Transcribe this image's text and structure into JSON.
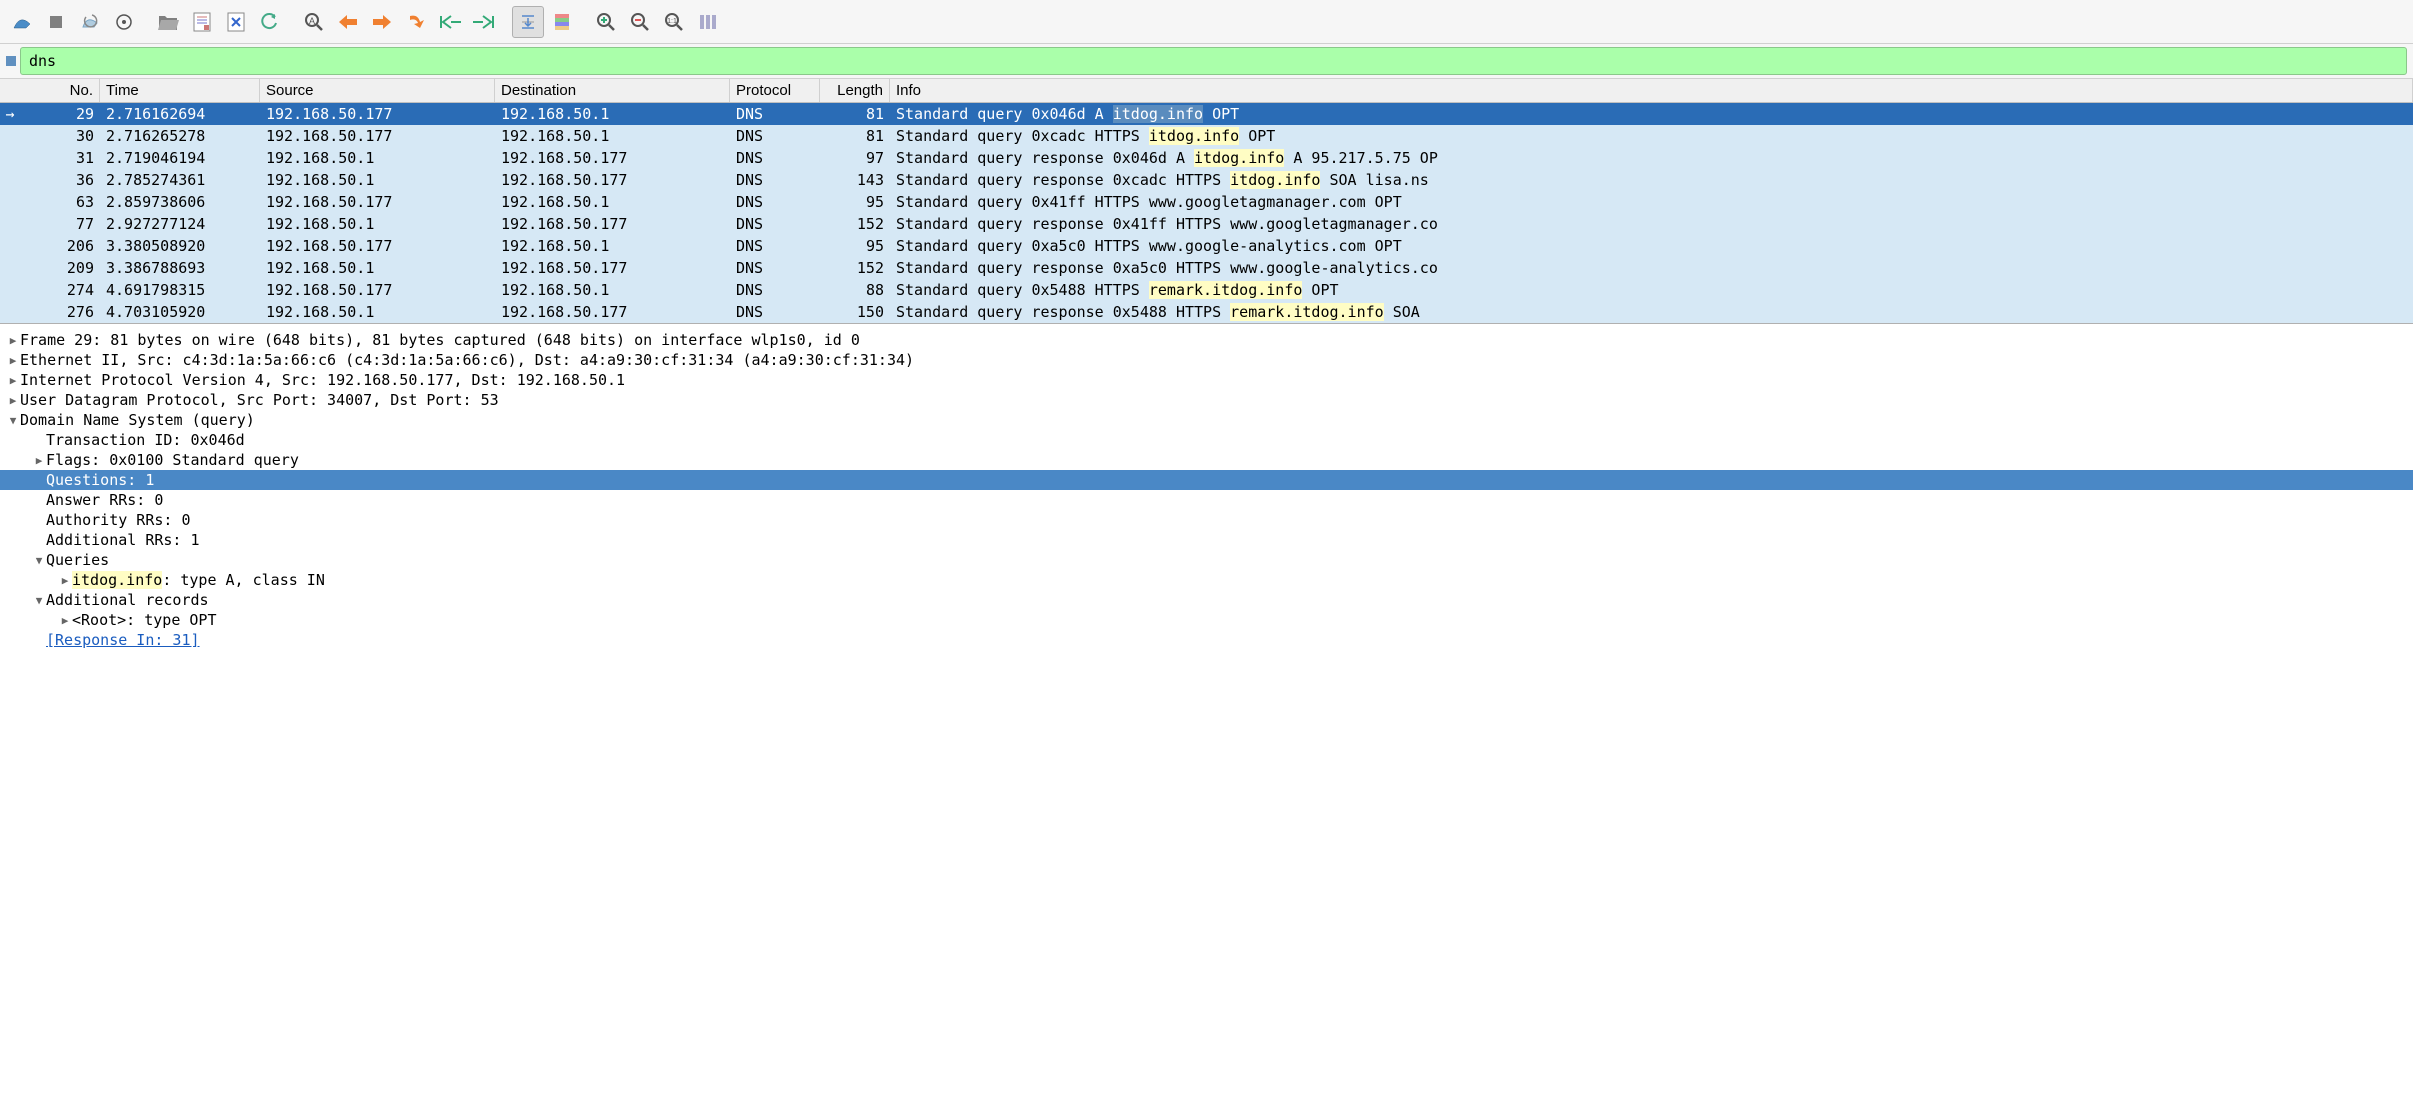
{
  "filter": {
    "value": "dns"
  },
  "columns": {
    "no": "No.",
    "time": "Time",
    "source": "Source",
    "destination": "Destination",
    "protocol": "Protocol",
    "length": "Length",
    "info": "Info"
  },
  "packets": [
    {
      "no": "29",
      "time": "2.716162694",
      "src": "192.168.50.177",
      "dst": "192.168.50.1",
      "proto": "DNS",
      "len": "81",
      "info_pre": "Standard query 0x046d A ",
      "info_hl": "itdog.info",
      "info_post": " OPT",
      "selected": true,
      "marker": "→"
    },
    {
      "no": "30",
      "time": "2.716265278",
      "src": "192.168.50.177",
      "dst": "192.168.50.1",
      "proto": "DNS",
      "len": "81",
      "info_pre": "Standard query 0xcadc HTTPS ",
      "info_hl": "itdog.info",
      "info_post": " OPT"
    },
    {
      "no": "31",
      "time": "2.719046194",
      "src": "192.168.50.1",
      "dst": "192.168.50.177",
      "proto": "DNS",
      "len": "97",
      "info_pre": "Standard query response 0x046d A ",
      "info_hl": "itdog.info",
      "info_post": " A 95.217.5.75 OP"
    },
    {
      "no": "36",
      "time": "2.785274361",
      "src": "192.168.50.1",
      "dst": "192.168.50.177",
      "proto": "DNS",
      "len": "143",
      "info_pre": "Standard query response 0xcadc HTTPS ",
      "info_hl": "itdog.info",
      "info_post": " SOA lisa.ns"
    },
    {
      "no": "63",
      "time": "2.859738606",
      "src": "192.168.50.177",
      "dst": "192.168.50.1",
      "proto": "DNS",
      "len": "95",
      "info_pre": "Standard query 0x41ff HTTPS www.googletagmanager.com OPT",
      "info_hl": "",
      "info_post": ""
    },
    {
      "no": "77",
      "time": "2.927277124",
      "src": "192.168.50.1",
      "dst": "192.168.50.177",
      "proto": "DNS",
      "len": "152",
      "info_pre": "Standard query response 0x41ff HTTPS www.googletagmanager.co",
      "info_hl": "",
      "info_post": ""
    },
    {
      "no": "206",
      "time": "3.380508920",
      "src": "192.168.50.177",
      "dst": "192.168.50.1",
      "proto": "DNS",
      "len": "95",
      "info_pre": "Standard query 0xa5c0 HTTPS www.google-analytics.com OPT",
      "info_hl": "",
      "info_post": ""
    },
    {
      "no": "209",
      "time": "3.386788693",
      "src": "192.168.50.1",
      "dst": "192.168.50.177",
      "proto": "DNS",
      "len": "152",
      "info_pre": "Standard query response 0xa5c0 HTTPS www.google-analytics.co",
      "info_hl": "",
      "info_post": ""
    },
    {
      "no": "274",
      "time": "4.691798315",
      "src": "192.168.50.177",
      "dst": "192.168.50.1",
      "proto": "DNS",
      "len": "88",
      "info_pre": "Standard query 0x5488 HTTPS ",
      "info_hl": "remark.itdog.info",
      "info_post": " OPT"
    },
    {
      "no": "276",
      "time": "4.703105920",
      "src": "192.168.50.1",
      "dst": "192.168.50.177",
      "proto": "DNS",
      "len": "150",
      "info_pre": "Standard query response 0x5488 HTTPS ",
      "info_hl": "remark.itdog.info",
      "info_post": " SOA "
    }
  ],
  "details": {
    "frame": "Frame 29: 81 bytes on wire (648 bits), 81 bytes captured (648 bits) on interface wlp1s0, id 0",
    "eth": "Ethernet II, Src: c4:3d:1a:5a:66:c6 (c4:3d:1a:5a:66:c6), Dst: a4:a9:30:cf:31:34 (a4:a9:30:cf:31:34)",
    "ip": "Internet Protocol Version 4, Src: 192.168.50.177, Dst: 192.168.50.1",
    "udp": "User Datagram Protocol, Src Port: 34007, Dst Port: 53",
    "dns": "Domain Name System (query)",
    "txid": "Transaction ID: 0x046d",
    "flags": "Flags: 0x0100 Standard query",
    "questions": "Questions: 1",
    "answer_rrs": "Answer RRs: 0",
    "authority_rrs": "Authority RRs: 0",
    "additional_rrs": "Additional RRs: 1",
    "queries_label": "Queries",
    "query_hl": "itdog.info",
    "query_rest": ": type A, class IN",
    "additional_records": "Additional records",
    "root_opt": "<Root>: type OPT",
    "response_in": "[Response In: 31]"
  },
  "toolbar_icons": [
    "shark-fin-icon",
    "stop-icon",
    "restart-icon",
    "options-icon",
    "sep",
    "open-icon",
    "save-icon",
    "close-file-icon",
    "reload-icon",
    "sep",
    "find-icon",
    "back-icon",
    "forward-icon",
    "jump-icon",
    "goto-first-icon",
    "goto-last-icon",
    "sep",
    "auto-scroll-icon",
    "colorize-icon",
    "sep",
    "zoom-in-icon",
    "zoom-out-icon",
    "zoom-reset-icon",
    "resize-columns-icon"
  ]
}
